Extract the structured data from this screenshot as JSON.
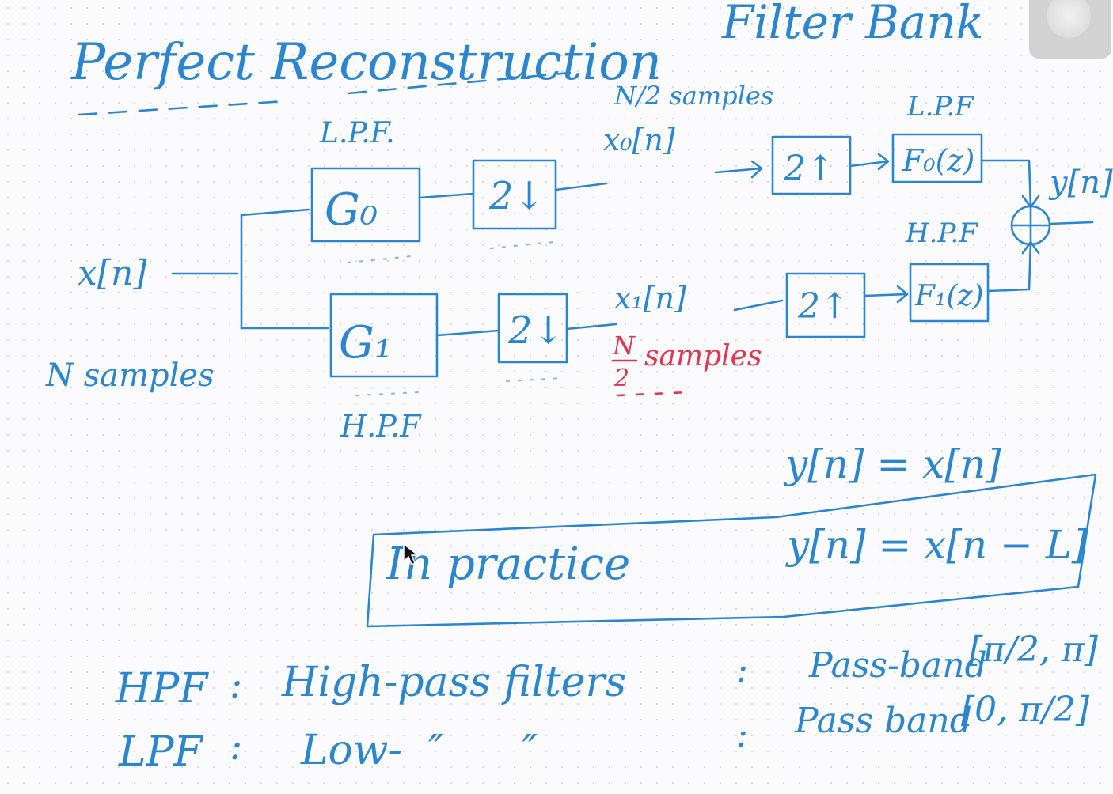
{
  "title": {
    "part1": "Perfect Reconstruction",
    "part2": "Filter Bank"
  },
  "input": {
    "signal": "x[n]",
    "samples": "N samples"
  },
  "analysis": {
    "upper": {
      "filter": "G₀",
      "type": "L.P.F.",
      "down": "2↓"
    },
    "lower": {
      "filter": "G₁",
      "type": "H.P.F",
      "down": "2↓"
    }
  },
  "mid": {
    "upper_samples": "N/2 samples",
    "upper_signal": "x₀[n]",
    "lower_signal": "x₁[n]",
    "lower_samples_num": "N",
    "lower_samples_den": "2",
    "lower_samples_word": "samples"
  },
  "synthesis": {
    "upper": {
      "up": "2↑",
      "filter": "F₀(z)",
      "type": "L.P.F"
    },
    "lower": {
      "up": "2↑",
      "filter": "F₁(z)",
      "type": "H.P.F"
    }
  },
  "output": {
    "signal": "y[n]"
  },
  "ideal_eq": "y[n] = x[n]",
  "practice": {
    "label": "In practice",
    "eq": "y[n] = x[n − L]"
  },
  "notes": [
    {
      "abbr": "HPF",
      "sep": ":",
      "desc": "High-pass filters",
      "sep2": ":",
      "band_label": "Pass-band",
      "band": "[π/2, π]"
    },
    {
      "abbr": "LPF",
      "sep": ":",
      "desc": "Low-  ″      ″",
      "sep2": ":",
      "band_label": "Pass band",
      "band": "[0, π/2]"
    }
  ]
}
